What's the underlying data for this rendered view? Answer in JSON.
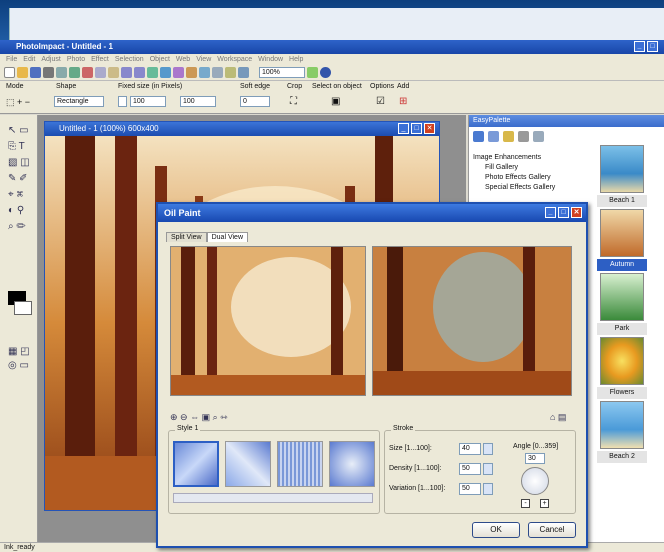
{
  "app": {
    "title": "PhotoImpact - Untitled - 1"
  },
  "menu": [
    "File",
    "Edit",
    "Adjust",
    "Photo",
    "Effect",
    "Selection",
    "Object",
    "Web",
    "View",
    "Workspace",
    "Window",
    "Help"
  ],
  "toolbar": {
    "zoom_value": "100%"
  },
  "props": {
    "mode_label": "Mode",
    "shape_label": "Shape",
    "shape_value": "Rectangle",
    "fixed_size_label": "Fixed size (in Pixels)",
    "width_value": "100",
    "height_value": "100",
    "soft_edge_label": "Soft edge",
    "soft_edge_value": "0",
    "crop_label": "Crop",
    "select_on_object_label": "Select on object",
    "options_label": "Options",
    "add_label": "Add"
  },
  "image_window": {
    "title": "Untitled - 1 (100%) 600x400"
  },
  "easy_palette": {
    "title": "EasyPalette",
    "tree": [
      "Image Enhancements",
      "Fill Gallery",
      "Photo Effects Gallery",
      "Special Effects Gallery"
    ],
    "thumbs": [
      "Beach 1",
      "Autumn",
      "Park",
      "Flowers",
      "Beach 2"
    ],
    "selected_thumb": "Autumn"
  },
  "dialog": {
    "title": "Oil Paint",
    "tabs": [
      "Split View",
      "Dual View"
    ],
    "active_tab": "Dual View",
    "style_group": "Style 1",
    "stroke_group": "Stroke",
    "size_label": "Size [1...100]:",
    "size_value": "40",
    "density_label": "Density [1...100]:",
    "density_value": "50",
    "variation_label": "Variation [1...100]:",
    "variation_value": "50",
    "angle_label": "Angle [0...359]",
    "angle_value": "30",
    "ok_label": "OK",
    "cancel_label": "Cancel"
  },
  "status": {
    "text": "Ink_ready"
  },
  "colors": {
    "titlebar": "#1846a8",
    "accent": "#2d5fc4",
    "close": "#d04020"
  }
}
